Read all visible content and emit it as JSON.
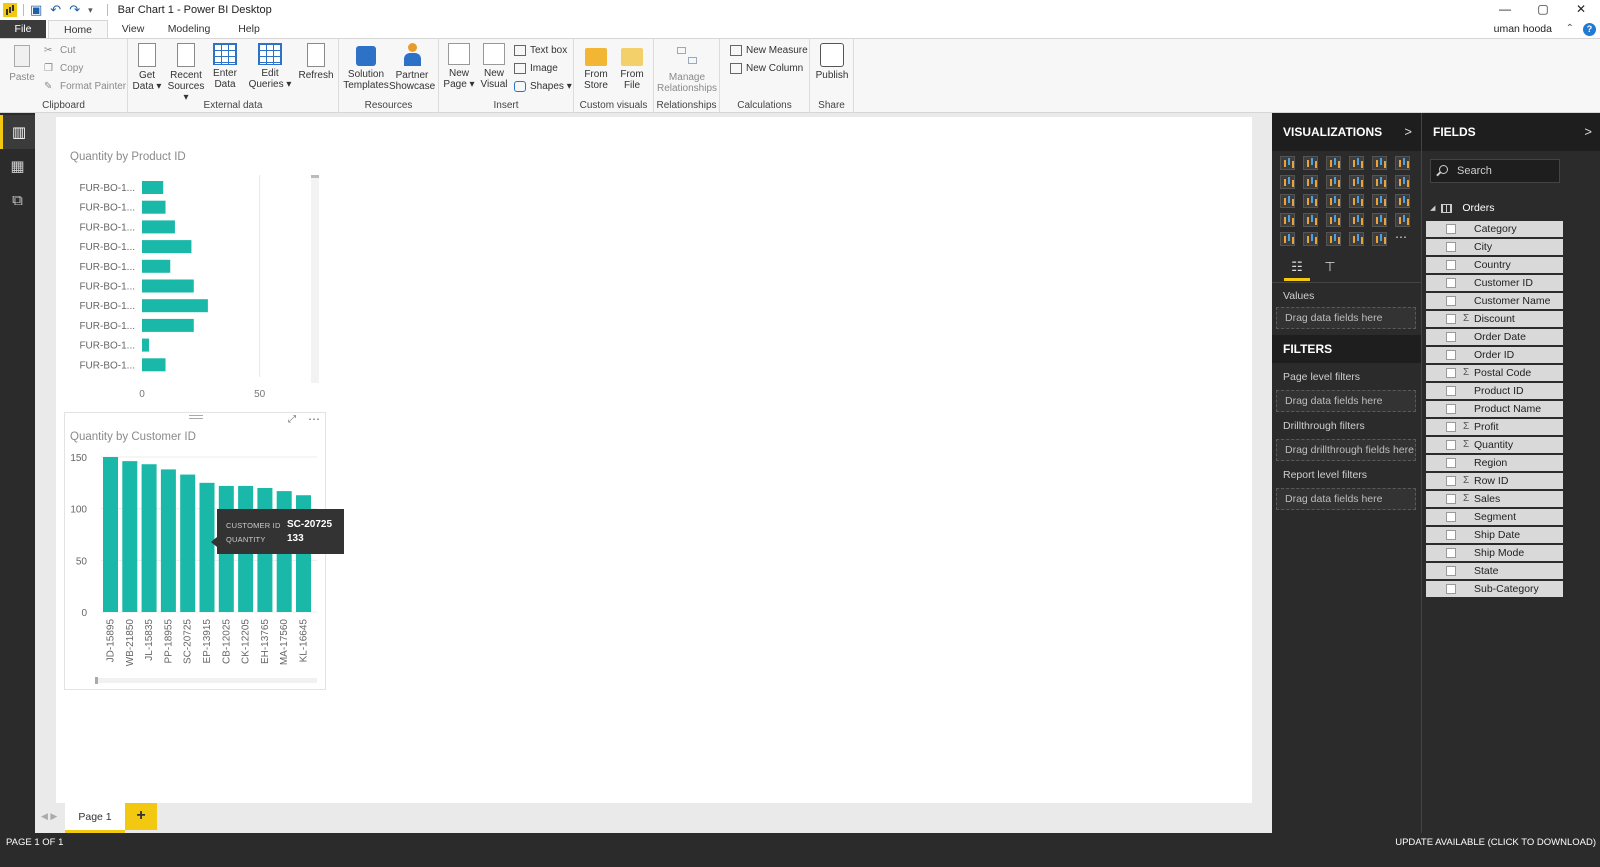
{
  "window": {
    "title": "Bar Chart 1 - Power BI Desktop",
    "controls": [
      "—",
      "▢",
      "✕"
    ]
  },
  "menu": {
    "tabs": [
      "File",
      "Home",
      "View",
      "Modeling",
      "Help"
    ],
    "active": "Home",
    "user": "uman hooda"
  },
  "ribbon": {
    "clipboard": {
      "label": "Clipboard",
      "paste": "Paste",
      "cut": "Cut",
      "copy": "Copy",
      "format_painter": "Format Painter"
    },
    "external_data": {
      "label": "External data",
      "get_data": [
        "Get",
        "Data ▾"
      ],
      "recent_sources": [
        "Recent",
        "Sources ▾"
      ],
      "enter_data": [
        "Enter",
        "Data"
      ],
      "edit_queries": [
        "Edit",
        "Queries ▾"
      ],
      "refresh": "Refresh"
    },
    "resources": {
      "label": "Resources",
      "solution_templates": [
        "Solution",
        "Templates"
      ],
      "partner_showcase": [
        "Partner",
        "Showcase"
      ]
    },
    "insert": {
      "label": "Insert",
      "new_page": [
        "New",
        "Page ▾"
      ],
      "new_visual": [
        "New",
        "Visual"
      ],
      "text_box": "Text box",
      "image": "Image",
      "shapes": "Shapes ▾"
    },
    "custom_visuals": {
      "label": "Custom visuals",
      "from_store": [
        "From",
        "Store"
      ],
      "from_file": [
        "From",
        "File"
      ]
    },
    "relationships": {
      "label": "Relationships",
      "manage": [
        "Manage",
        "Relationships"
      ]
    },
    "calculations": {
      "label": "Calculations",
      "new_measure": "New Measure",
      "new_column": "New Column"
    },
    "share": {
      "label": "Share",
      "publish": "Publish"
    }
  },
  "pages": {
    "tabs": [
      "Page 1"
    ],
    "add": "+"
  },
  "status": {
    "left": "PAGE 1 OF 1",
    "right": "UPDATE AVAILABLE (CLICK TO DOWNLOAD)"
  },
  "tooltip": {
    "k1": "CUSTOMER ID",
    "v1": "SC-20725",
    "k2": "QUANTITY",
    "v2": "133"
  },
  "visualizations": {
    "title": "VISUALIZATIONS",
    "values_label": "Values",
    "values_drop": "Drag data fields here",
    "filters_title": "FILTERS",
    "page_filters": "Page level filters",
    "page_drop": "Drag data fields here",
    "drill_filters": "Drillthrough filters",
    "drill_drop": "Drag drillthrough fields here",
    "report_filters": "Report level filters",
    "report_drop": "Drag data fields here",
    "more": "⋯"
  },
  "fields": {
    "title": "FIELDS",
    "search_placeholder": "Search",
    "table": "Orders",
    "items": [
      {
        "name": "Category",
        "sigma": ""
      },
      {
        "name": "City",
        "sigma": ""
      },
      {
        "name": "Country",
        "sigma": ""
      },
      {
        "name": "Customer ID",
        "sigma": ""
      },
      {
        "name": "Customer Name",
        "sigma": ""
      },
      {
        "name": "Discount",
        "sigma": "Σ"
      },
      {
        "name": "Order Date",
        "sigma": ""
      },
      {
        "name": "Order ID",
        "sigma": ""
      },
      {
        "name": "Postal Code",
        "sigma": "Σ"
      },
      {
        "name": "Product ID",
        "sigma": ""
      },
      {
        "name": "Product Name",
        "sigma": ""
      },
      {
        "name": "Profit",
        "sigma": "Σ"
      },
      {
        "name": "Quantity",
        "sigma": "Σ"
      },
      {
        "name": "Region",
        "sigma": ""
      },
      {
        "name": "Row ID",
        "sigma": "Σ"
      },
      {
        "name": "Sales",
        "sigma": "Σ"
      },
      {
        "name": "Segment",
        "sigma": ""
      },
      {
        "name": "Ship Date",
        "sigma": ""
      },
      {
        "name": "Ship Mode",
        "sigma": ""
      },
      {
        "name": "State",
        "sigma": ""
      },
      {
        "name": "Sub-Category",
        "sigma": ""
      }
    ]
  },
  "colors": {
    "bar": "#1ab8a8",
    "accent": "#f2c811",
    "pane": "#2b2b2b"
  },
  "chart_data": [
    {
      "type": "bar",
      "orientation": "horizontal",
      "title": "Quantity by Product ID",
      "categories": [
        "FUR-BO-1...",
        "FUR-BO-1...",
        "FUR-BO-1...",
        "FUR-BO-1...",
        "FUR-BO-1...",
        "FUR-BO-1...",
        "FUR-BO-1...",
        "FUR-BO-1...",
        "FUR-BO-1...",
        "FUR-BO-1..."
      ],
      "values": [
        9,
        10,
        14,
        21,
        12,
        22,
        28,
        22,
        3,
        10
      ],
      "xlim": [
        0,
        85
      ],
      "ticks": [
        0,
        50
      ]
    },
    {
      "type": "bar",
      "orientation": "vertical",
      "title": "Quantity by Customer ID",
      "categories": [
        "JD-15895",
        "WB-21850",
        "JL-15835",
        "PP-18955",
        "SC-20725",
        "EP-13915",
        "CB-12025",
        "CK-12205",
        "EH-13765",
        "MA-17560",
        "KL-16645"
      ],
      "values": [
        150,
        146,
        143,
        138,
        133,
        125,
        122,
        122,
        120,
        117,
        113
      ],
      "ylim": [
        0,
        150
      ],
      "ticks": [
        0,
        50,
        100,
        150
      ]
    }
  ]
}
